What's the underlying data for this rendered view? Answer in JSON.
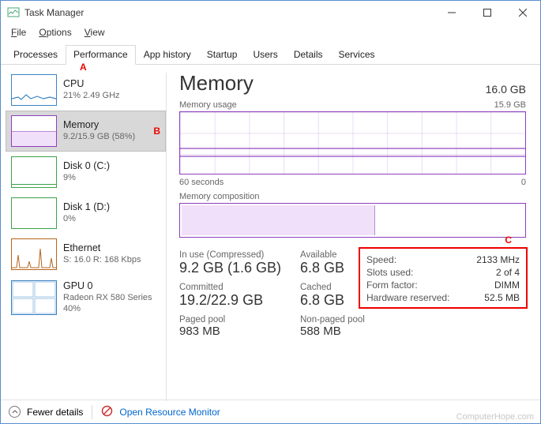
{
  "window": {
    "title": "Task Manager"
  },
  "menu": {
    "file": "File",
    "options": "Options",
    "view": "View"
  },
  "tabs": {
    "processes": "Processes",
    "performance": "Performance",
    "apphistory": "App history",
    "startup": "Startup",
    "users": "Users",
    "details": "Details",
    "services": "Services"
  },
  "annotations": {
    "a": "A",
    "b": "B",
    "c": "C"
  },
  "sidebar": [
    {
      "name": "CPU",
      "sub": "21% 2.49 GHz"
    },
    {
      "name": "Memory",
      "sub": "9.2/15.9 GB (58%)"
    },
    {
      "name": "Disk 0 (C:)",
      "sub": "9%"
    },
    {
      "name": "Disk 1 (D:)",
      "sub": "0%"
    },
    {
      "name": "Ethernet",
      "sub": "S: 16.0  R: 168 Kbps"
    },
    {
      "name": "GPU 0",
      "sub": "Radeon RX 580 Series\n40%"
    }
  ],
  "detail": {
    "title": "Memory",
    "capacity": "16.0 GB",
    "usage_label": "Memory usage",
    "usage_right": "15.9 GB",
    "axis_left": "60 seconds",
    "axis_right": "0",
    "comp_label": "Memory composition",
    "stats": {
      "inuse_lbl": "In use (Compressed)",
      "inuse_val": "9.2 GB (1.6 GB)",
      "available_lbl": "Available",
      "available_val": "6.8 GB",
      "committed_lbl": "Committed",
      "committed_val": "19.2/22.9 GB",
      "cached_lbl": "Cached",
      "cached_val": "6.8 GB",
      "paged_lbl": "Paged pool",
      "paged_val": "983 MB",
      "nonpaged_lbl": "Non-paged pool",
      "nonpaged_val": "588 MB"
    },
    "spec": {
      "speed_k": "Speed:",
      "speed_v": "2133 MHz",
      "slots_k": "Slots used:",
      "slots_v": "2 of 4",
      "form_k": "Form factor:",
      "form_v": "DIMM",
      "hw_k": "Hardware reserved:",
      "hw_v": "52.5 MB"
    }
  },
  "footer": {
    "fewer": "Fewer details",
    "orm": "Open Resource Monitor"
  },
  "watermark": "ComputerHope.com",
  "chart_data": {
    "type": "line",
    "title": "Memory usage",
    "xlabel": "seconds ago",
    "ylabel": "GB",
    "x_range": [
      60,
      0
    ],
    "ylim": [
      0,
      15.9
    ],
    "series": [
      {
        "name": "In use",
        "approx_value": 9.2,
        "flat": true
      }
    ],
    "composition": {
      "total_gb": 15.9,
      "in_use_gb": 9.2,
      "compressed_gb": 1.6,
      "available_gb": 6.8
    }
  }
}
